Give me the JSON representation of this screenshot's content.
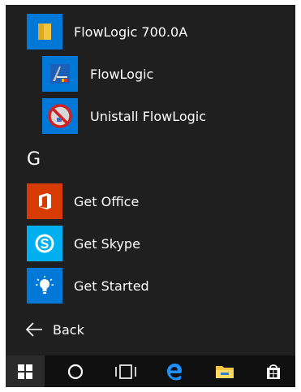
{
  "colors": {
    "tile_blue": "#0078d7",
    "office_orange": "#d83b01",
    "skype_blue": "#00aff0",
    "menu_bg": "#1f1f1f",
    "taskbar_bg": "#101010"
  },
  "apps": {
    "folder": {
      "label": "FlowLogic 700.0A",
      "icon": "folder-icon"
    },
    "flowlogic": {
      "label": "FlowLogic",
      "icon": "flowlogic-app-icon"
    },
    "uninstall": {
      "label": "Unistall FlowLogic",
      "icon": "uninstall-icon"
    },
    "section_letter": "G",
    "get_office": {
      "label": "Get Office",
      "icon": "office-icon"
    },
    "get_skype": {
      "label": "Get Skype",
      "icon": "skype-icon"
    },
    "get_started": {
      "label": "Get Started",
      "icon": "lightbulb-icon"
    }
  },
  "back": {
    "label": "Back",
    "icon": "back-arrow-icon"
  },
  "taskbar": {
    "items": [
      "windows-start-icon",
      "cortana-circle-icon",
      "task-view-icon",
      "edge-icon",
      "file-explorer-icon",
      "store-icon"
    ]
  }
}
